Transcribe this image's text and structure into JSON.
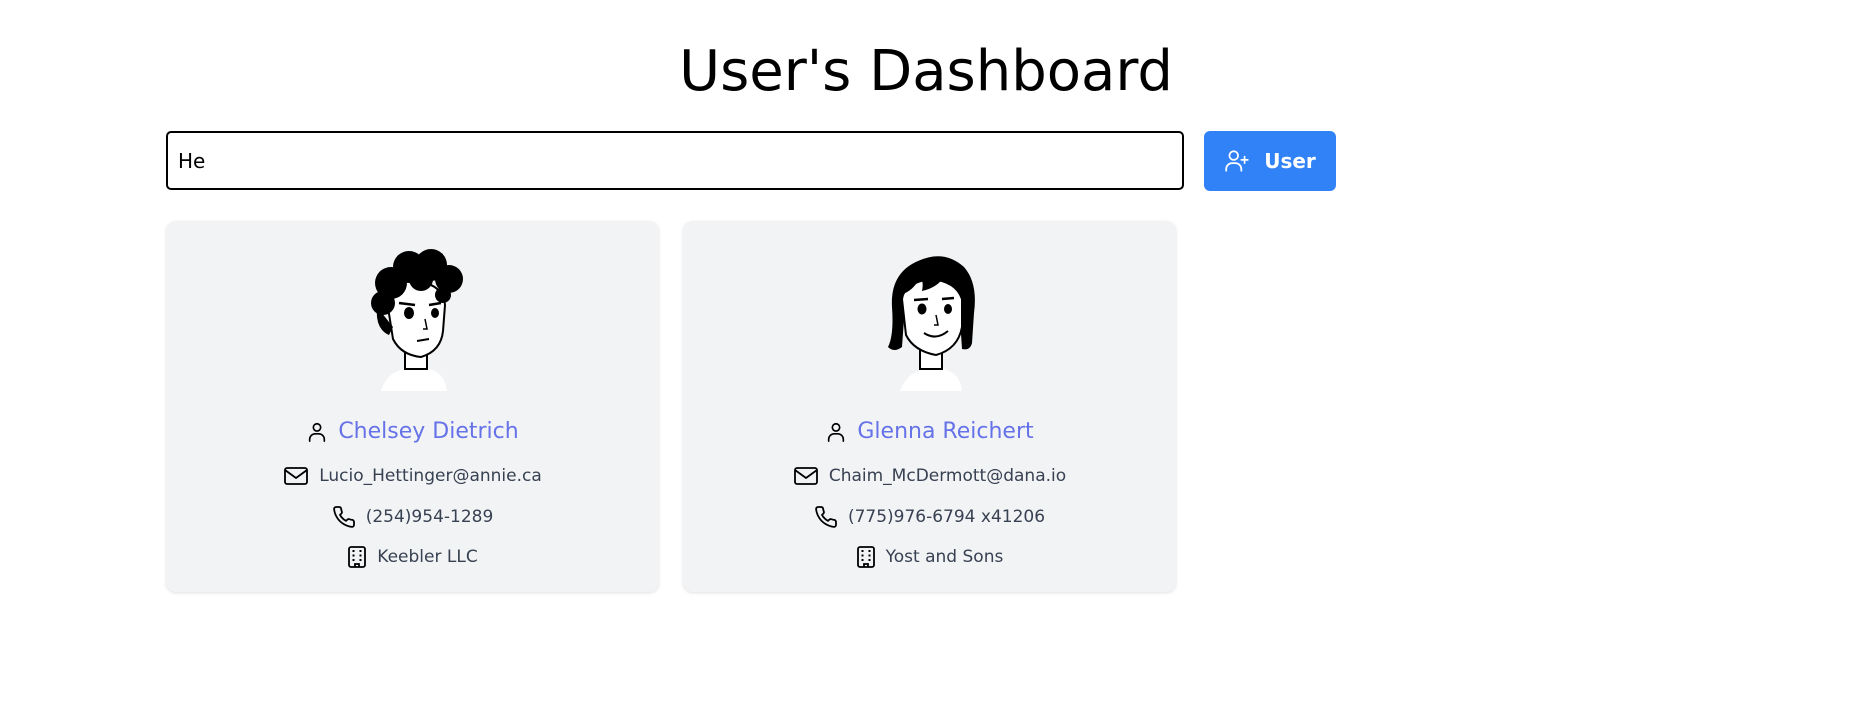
{
  "header": {
    "title": "User's Dashboard"
  },
  "search": {
    "value": "He"
  },
  "toolbar": {
    "add_user_label": "User",
    "add_user_icon": "user-plus-icon",
    "button_color": "#3182f6"
  },
  "users": [
    {
      "name": "Chelsey Dietrich",
      "email": "Lucio_Hettinger@annie.ca",
      "phone": "(254)954-1289",
      "company": "Keebler LLC",
      "avatar_icon": "curly-hair-avatar-icon"
    },
    {
      "name": "Glenna Reichert",
      "email": "Chaim_McDermott@dana.io",
      "phone": "(775)976-6794 x41206",
      "company": "Yost and Sons",
      "avatar_icon": "shoulder-length-hair-avatar-icon"
    }
  ],
  "colors": {
    "name_link": "#6672e8",
    "card_background": "#f2f3f5",
    "info_text": "#374151"
  }
}
